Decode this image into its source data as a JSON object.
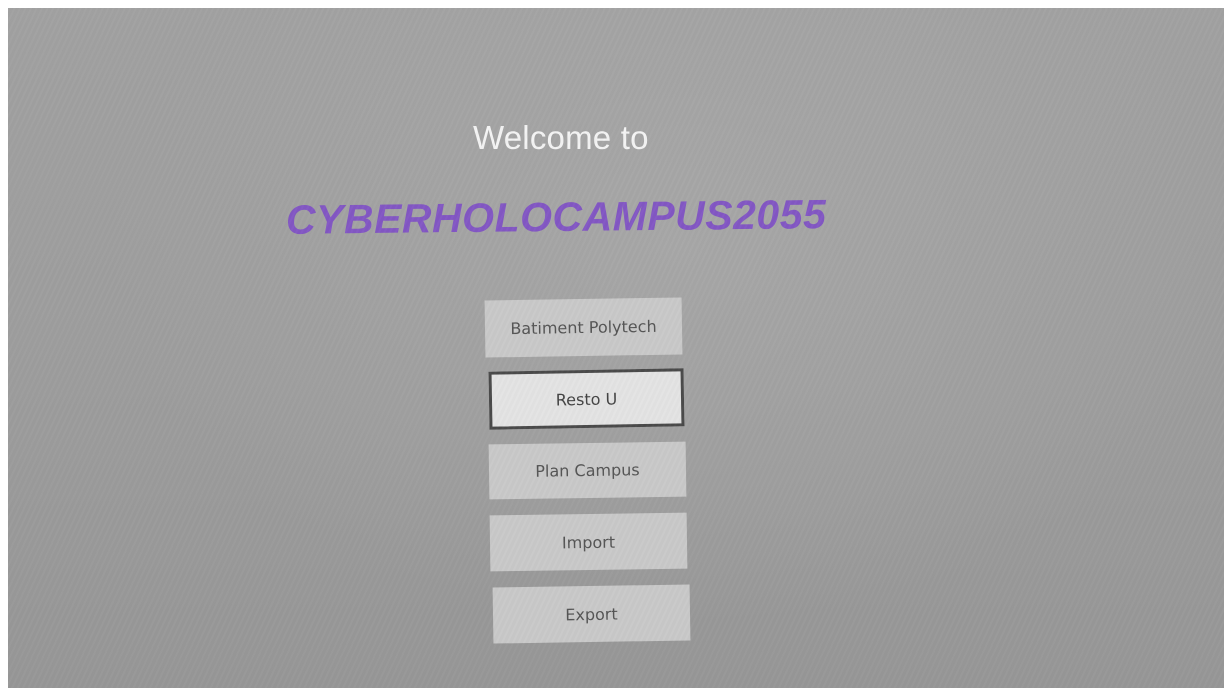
{
  "header": {
    "welcome_text": "Welcome to",
    "app_name": "CYBERHOLOCAMPUS2055"
  },
  "menu": {
    "items": [
      {
        "label": "Batiment Polytech",
        "selected": false
      },
      {
        "label": "Resto U",
        "selected": true
      },
      {
        "label": "Plan Campus",
        "selected": false
      },
      {
        "label": "Import",
        "selected": false
      },
      {
        "label": "Export",
        "selected": false
      }
    ]
  },
  "colors": {
    "brand": "#8357c4",
    "background": "#9f9f9f",
    "button": "#c9c9c9",
    "button_selected": "#e4e4e4",
    "selected_border": "#4a4a4a"
  }
}
